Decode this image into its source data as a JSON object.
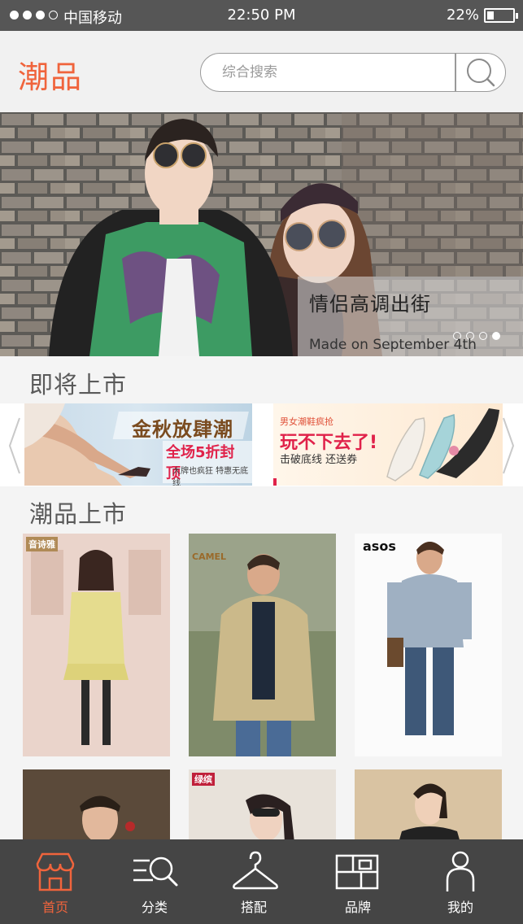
{
  "status_bar": {
    "carrier": "中国移动",
    "time": "22:50 PM",
    "battery_pct": "22%"
  },
  "header": {
    "logo": "潮品",
    "search_placeholder": "综合搜索"
  },
  "banner": {
    "title": "情侣高调出街",
    "subtitle": "Made on September 4th",
    "active_page": 4,
    "page_count": 4
  },
  "sections": {
    "upcoming": "即将上市",
    "new_arrivals": "潮品上市"
  },
  "promos": [
    {
      "headline": "金秋放肆潮",
      "highlight": "全场5折封顶",
      "note": "大牌也疯狂 特惠无底线"
    },
    {
      "tag": "男女潮鞋疯抢",
      "headline": "玩不下去了!",
      "note": "击破底线  还送券"
    }
  ],
  "products": [
    {
      "brand": "音诗雅"
    },
    {
      "brand": "CAMEL"
    },
    {
      "brand": "asos"
    },
    {
      "brand": ""
    },
    {
      "brand": "绿缤"
    },
    {
      "brand": ""
    }
  ],
  "tabbar": {
    "items": [
      {
        "label": "首页",
        "icon": "home-icon",
        "active": true
      },
      {
        "label": "分类",
        "icon": "category-icon",
        "active": false
      },
      {
        "label": "搭配",
        "icon": "hanger-icon",
        "active": false
      },
      {
        "label": "品牌",
        "icon": "brand-icon",
        "active": false
      },
      {
        "label": "我的",
        "icon": "profile-icon",
        "active": false
      }
    ]
  },
  "colors": {
    "accent": "#f0643c",
    "status_bar": "#565656",
    "tabbar": "#454545"
  }
}
